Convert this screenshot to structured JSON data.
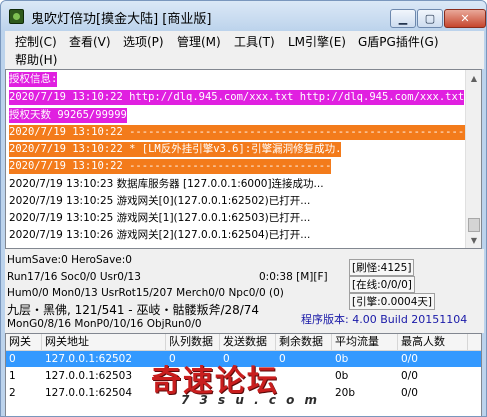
{
  "window": {
    "title": "鬼吹灯倍功[摸金大陆] [商业版]",
    "min_glyph": "▁",
    "max_glyph": "▢",
    "close_glyph": "✕"
  },
  "menu": [
    "控制(C)",
    "查看(V)",
    "选项(P)",
    "管理(M)",
    "工具(T)",
    "LM引擎(E)",
    "G盾PG插件(G)",
    "帮助(H)"
  ],
  "log": [
    {
      "text": "授权信息:",
      "style": "magenta"
    },
    {
      "text": "2020/7/19 13:10:22 http://dlq.945.com/xxx.txt http://dlq.945.com/xxx.txt",
      "style": "magenta"
    },
    {
      "text": "授权天数 99265/99999",
      "style": "magenta"
    },
    {
      "text": "2020/7/19 13:10:22 ------------------------------------------------------",
      "style": "orange"
    },
    {
      "text": "2020/7/19 13:10:22 * [LM反外挂引擎v3.6]:引擎漏洞修复成功.",
      "style": "orange"
    },
    {
      "text": "2020/7/19 13:10:22 --------------------------------",
      "style": "orange"
    },
    {
      "text": "2020/7/19 13:10:23 数据库服务器 [127.0.0.1:6000]连接成功...",
      "style": "plain"
    },
    {
      "text": "2020/7/19 13:10:25 游戏网关[0](127.0.0.1:62502)已打开...",
      "style": "plain"
    },
    {
      "text": "2020/7/19 13:10:25 游戏网关[1](127.0.0.1:62503)已打开...",
      "style": "plain"
    },
    {
      "text": "2020/7/19 13:10:26 游戏网关[2](127.0.0.1:62504)已打开...",
      "style": "plain"
    }
  ],
  "status": {
    "line1": "HumSave:0 HeroSave:0",
    "line2": "Run17/16 Soc0/0 Usr0/13",
    "line2_time": "0:0:38 [M][F]",
    "line3": "Hum0/0 Mon0/13 UsrRot15/207 Merch0/0 Npc0/0 (0)",
    "line4": "九层・黑佛, 121/541 - 巫岐・骷髅叛斧/28/74",
    "line5": "MonG0/8/16 MonP0/10/16 ObjRun0/0",
    "box_refresh": "[刷怪:4125]",
    "box_online": "[在线:0/0/0]",
    "box_engine": "[引擎:0.0004天]",
    "version": "程序版本: 4.00 Build 20151104"
  },
  "table": {
    "headers": [
      "网关",
      "网关地址",
      "队列数据",
      "发送数据",
      "剩余数据",
      "平均流量",
      "最高人数"
    ],
    "rows": [
      [
        "0",
        "127.0.0.1:62502",
        "0",
        "0",
        "0",
        "0b",
        "0/0"
      ],
      [
        "1",
        "127.0.0.1:62503",
        "",
        "",
        "",
        "0b",
        "0/0"
      ],
      [
        "2",
        "127.0.0.1:62504",
        "",
        "",
        "",
        "20b",
        "0/0"
      ]
    ]
  },
  "watermark": {
    "main": "奇速论坛",
    "sub": "7 3 s u . c o m"
  },
  "colors": {
    "magenta": "#e020e0",
    "orange": "#f37b1b",
    "selection": "#3399ff",
    "version_text": "#1a1aa8",
    "watermark": "#c91e1e"
  }
}
